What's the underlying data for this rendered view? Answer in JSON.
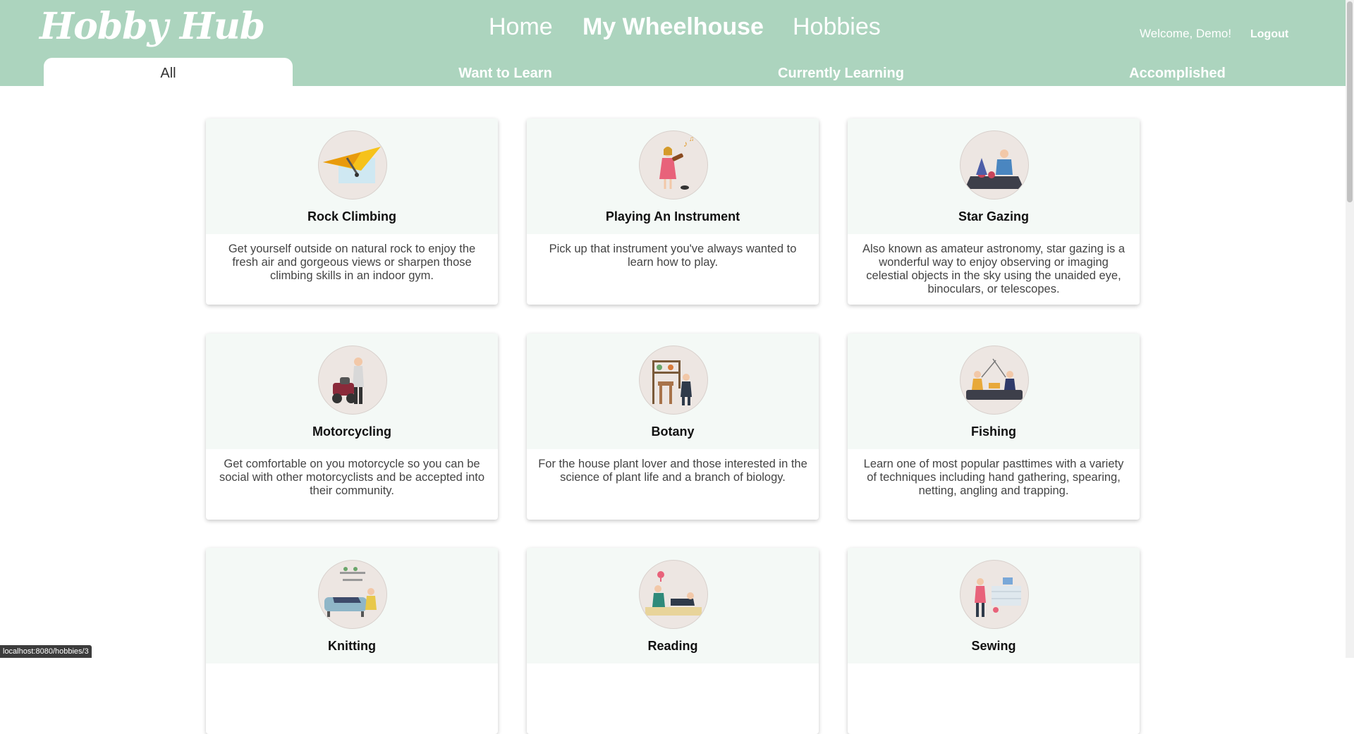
{
  "header": {
    "logo": "Hobby Hub",
    "nav": [
      {
        "label": "Home",
        "active": false
      },
      {
        "label": "My Wheelhouse",
        "active": true
      },
      {
        "label": "Hobbies",
        "active": false
      }
    ],
    "welcome": "Welcome, Demo!",
    "logout": "Logout"
  },
  "tabs": [
    {
      "label": "All",
      "active": true
    },
    {
      "label": "Want to Learn",
      "active": false
    },
    {
      "label": "Currently Learning",
      "active": false
    },
    {
      "label": "Accomplished",
      "active": false
    }
  ],
  "cards": [
    {
      "title": "Rock Climbing",
      "description": "Get yourself outside on natural rock to enjoy the fresh air and gorgeous views or sharpen those climbing skills in an indoor gym.",
      "icon": "hang-glider-icon"
    },
    {
      "title": "Playing An Instrument",
      "description": "Pick up that instrument you've always wanted to learn how to play.",
      "icon": "violinist-icon"
    },
    {
      "title": "Star Gazing",
      "description": "Also known as amateur astronomy, star gazing is a wonderful way to enjoy observing or imaging celestial objects in the sky using the unaided eye, binoculars, or telescopes.",
      "icon": "picnic-stargazers-icon"
    },
    {
      "title": "Motorcycling",
      "description": "Get comfortable on you motorcycle so you can be social with other motorcyclists and be accepted into their community.",
      "icon": "motorcyclist-icon"
    },
    {
      "title": "Botany",
      "description": "For the house plant lover and those interested in the science of plant life and a branch of biology.",
      "icon": "plant-shelf-icon"
    },
    {
      "title": "Fishing",
      "description": "Learn one of most popular pasttimes with a variety of techniques including hand gathering, spearing, netting, angling and trapping.",
      "icon": "fishers-icon"
    },
    {
      "title": "Knitting",
      "description": "",
      "icon": "sofa-knitter-icon"
    },
    {
      "title": "Reading",
      "description": "",
      "icon": "readers-icon"
    },
    {
      "title": "Sewing",
      "description": "",
      "icon": "sewing-workshop-icon"
    }
  ],
  "status_bar": "localhost:8080/hobbies/3",
  "colors": {
    "header": "#acd4be",
    "card_top": "#f4f9f6",
    "avatar_bg": "#ede6e2"
  }
}
